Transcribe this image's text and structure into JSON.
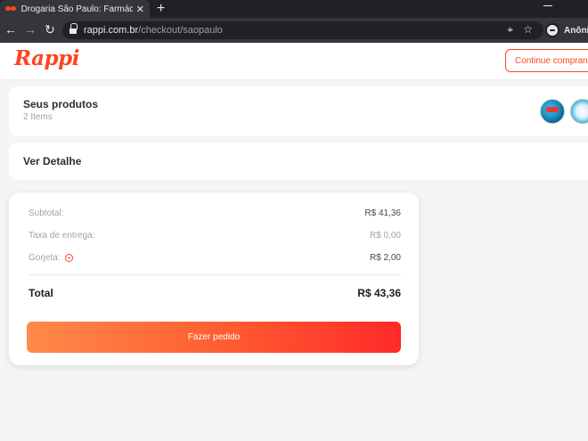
{
  "browser": {
    "tab_title": "Drogaria São Paulo: Farmácia Deli",
    "tab_close": "✕",
    "new_tab": "+",
    "url_host": "rappi.com.br",
    "url_path": "/checkout/saopaulo",
    "profile_name": "Anônim"
  },
  "header": {
    "logo": "Rappi",
    "continue_button": "Continue comprando"
  },
  "products": {
    "title": "Seus produtos",
    "count": "2 Items"
  },
  "detail": {
    "title": "Ver Detalhe"
  },
  "summary": {
    "subtotal_label": "Subtotal:",
    "subtotal_value": "R$ 41,36",
    "delivery_label": "Taxa de entrega:",
    "delivery_value": "R$ 0,00",
    "tip_label": "Gorjeta:",
    "tip_value": "R$ 2,00",
    "total_label": "Total",
    "total_value": "R$ 43,36",
    "order_button": "Fazer pedido"
  },
  "colors": {
    "brand": "#ff441f",
    "button_gradient_start": "#ff8a4a",
    "button_gradient_end": "#ff2a2a"
  }
}
